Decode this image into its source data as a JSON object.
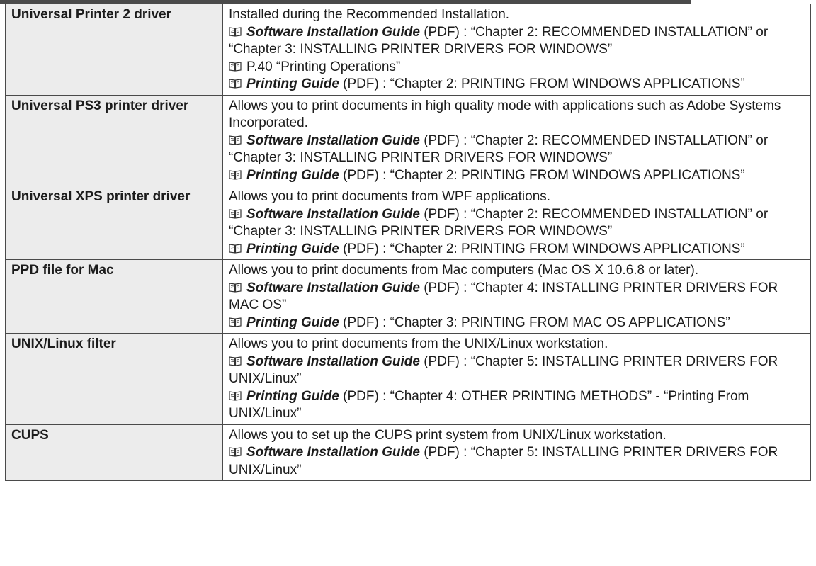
{
  "rows": [
    {
      "name": "Universal Printer 2 driver",
      "description": "Installed during the Recommended Installation.",
      "refs": [
        {
          "icon": "book-icon",
          "title": "Software Installation Guide",
          "text": " (PDF) : “Chapter 2: RECOMMENDED INSTALLATION” or “Chapter 3: INSTALLING PRINTER DRIVERS FOR WINDOWS”"
        },
        {
          "icon": "book-icon",
          "title": "",
          "text": "P.40  “Printing Operations”"
        },
        {
          "icon": "book-icon",
          "title": "Printing Guide",
          "text": " (PDF) : “Chapter 2: PRINTING FROM WINDOWS APPLICATIONS”"
        }
      ]
    },
    {
      "name": "Universal PS3 printer driver",
      "description": "Allows you to print documents in high quality mode with applications such as Adobe Systems Incorporated.",
      "refs": [
        {
          "icon": "book-icon",
          "title": "Software Installation Guide",
          "text": " (PDF) : “Chapter 2: RECOMMENDED INSTALLATION” or “Chapter 3: INSTALLING PRINTER DRIVERS FOR WINDOWS”"
        },
        {
          "icon": "book-icon",
          "title": "Printing Guide",
          "text": " (PDF) : “Chapter 2: PRINTING FROM WINDOWS APPLICATIONS”"
        }
      ]
    },
    {
      "name": "Universal XPS printer driver",
      "description": "Allows you to print documents from WPF applications.",
      "refs": [
        {
          "icon": "book-icon",
          "title": "Software Installation Guide",
          "text": " (PDF) : “Chapter 2: RECOMMENDED INSTALLATION” or “Chapter 3: INSTALLING PRINTER DRIVERS FOR WINDOWS”"
        },
        {
          "icon": "book-icon",
          "title": "Printing Guide",
          "text": " (PDF) : “Chapter 2: PRINTING FROM WINDOWS APPLICATIONS”"
        }
      ]
    },
    {
      "name": "PPD file for Mac",
      "description": "Allows you to print documents from Mac computers (Mac OS X 10.6.8 or later).",
      "refs": [
        {
          "icon": "book-icon",
          "title": "Software Installation Guide",
          "text": " (PDF) : “Chapter 4: INSTALLING PRINTER DRIVERS FOR MAC OS”"
        },
        {
          "icon": "book-icon",
          "title": "Printing Guide",
          "text": " (PDF) : “Chapter 3: PRINTING FROM MAC OS APPLICATIONS”"
        }
      ]
    },
    {
      "name": "UNIX/Linux filter",
      "description": "Allows you to print documents from the UNIX/Linux workstation.",
      "refs": [
        {
          "icon": "book-icon",
          "title": "Software Installation Guide",
          "text": " (PDF) : “Chapter 5: INSTALLING PRINTER DRIVERS FOR UNIX/Linux”"
        },
        {
          "icon": "book-icon",
          "title": "Printing Guide",
          "text": " (PDF) : “Chapter 4: OTHER PRINTING METHODS” - “Printing From UNIX/Linux”"
        }
      ]
    },
    {
      "name": "CUPS",
      "description": "Allows you to set up the CUPS print system from UNIX/Linux workstation.",
      "refs": [
        {
          "icon": "book-icon",
          "title": "Software Installation Guide",
          "text": " (PDF) : “Chapter 5: INSTALLING PRINTER DRIVERS FOR UNIX/Linux”"
        }
      ]
    }
  ]
}
